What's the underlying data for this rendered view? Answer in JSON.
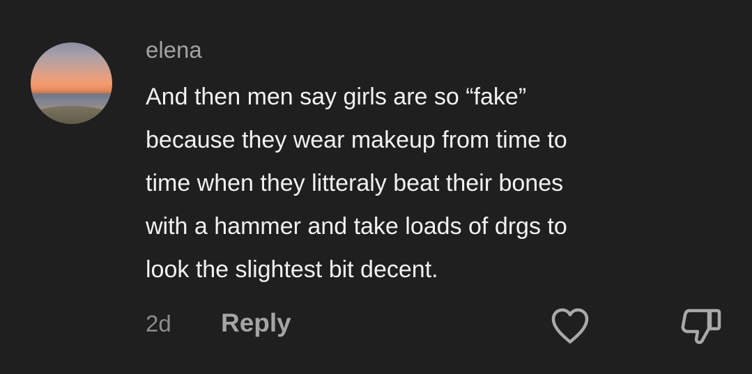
{
  "comment": {
    "username": "elena",
    "text": "And then men say girls are so “fake”\nbecause they wear makeup from time to\ntime when they litteraly beat their bones\nwith a hammer and take loads of drgs to\nlook the slightest bit decent.",
    "age": "2d",
    "reply_label": "Reply"
  },
  "icons": {
    "like": "heart-icon",
    "dislike": "thumbs-down-icon"
  },
  "colors": {
    "background": "#1f1f1f",
    "username": "#a3a3a3",
    "text": "#f2f2f2",
    "meta": "#8d8d8d",
    "reply": "#a5a5a5",
    "icon": "#a9a9a9"
  }
}
